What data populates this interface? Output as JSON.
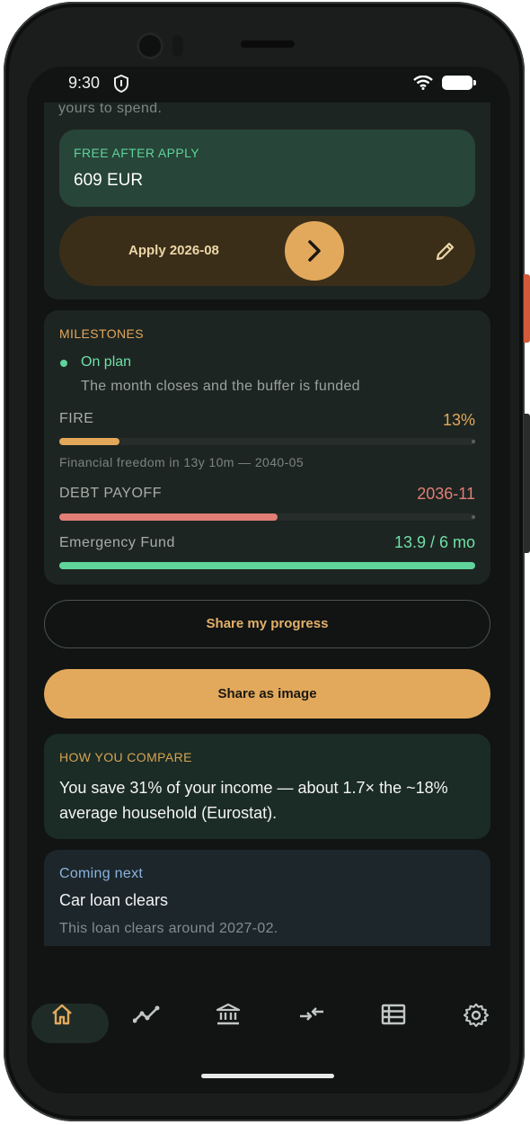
{
  "status_bar": {
    "time": "9:30"
  },
  "budget": {
    "intro_text": "yours to spend.",
    "free_after_apply_label": "FREE AFTER APPLY",
    "free_after_apply_value": "609 EUR",
    "apply_label": "Apply 2026-08"
  },
  "milestones": {
    "title": "MILESTONES",
    "status": "On plan",
    "status_desc": "The month closes and the buffer is funded",
    "fire": {
      "label": "FIRE",
      "value": "13%",
      "progress": 0.145,
      "note": "Financial freedom in 13y 10m — 2040-05"
    },
    "debt": {
      "label": "DEBT PAYOFF",
      "value": "2036-11",
      "progress": 0.525
    },
    "emergency": {
      "label": "Emergency Fund",
      "value": "13.9 / 6 mo",
      "progress": 1.0
    }
  },
  "actions": {
    "share_progress": "Share my progress",
    "share_image": "Share as image"
  },
  "compare": {
    "title": "HOW YOU COMPARE",
    "text": "You save 31% of your income — about 1.7× the ~18% average household (Eurostat)."
  },
  "coming_next": {
    "title": "Coming next",
    "headline": "Car loan clears",
    "desc": "This loan clears around 2027-02."
  },
  "nav": {
    "items": [
      {
        "icon": "home-icon",
        "active": true
      },
      {
        "icon": "trend-icon",
        "active": false
      },
      {
        "icon": "bank-icon",
        "active": false
      },
      {
        "icon": "transfer-icon",
        "active": false
      },
      {
        "icon": "list-icon",
        "active": false
      },
      {
        "icon": "settings-icon",
        "active": false
      }
    ]
  },
  "colors": {
    "accent": "#e2a95c",
    "positive": "#5fd49b",
    "debt": "#e07e75",
    "info": "#8ab4dc"
  }
}
